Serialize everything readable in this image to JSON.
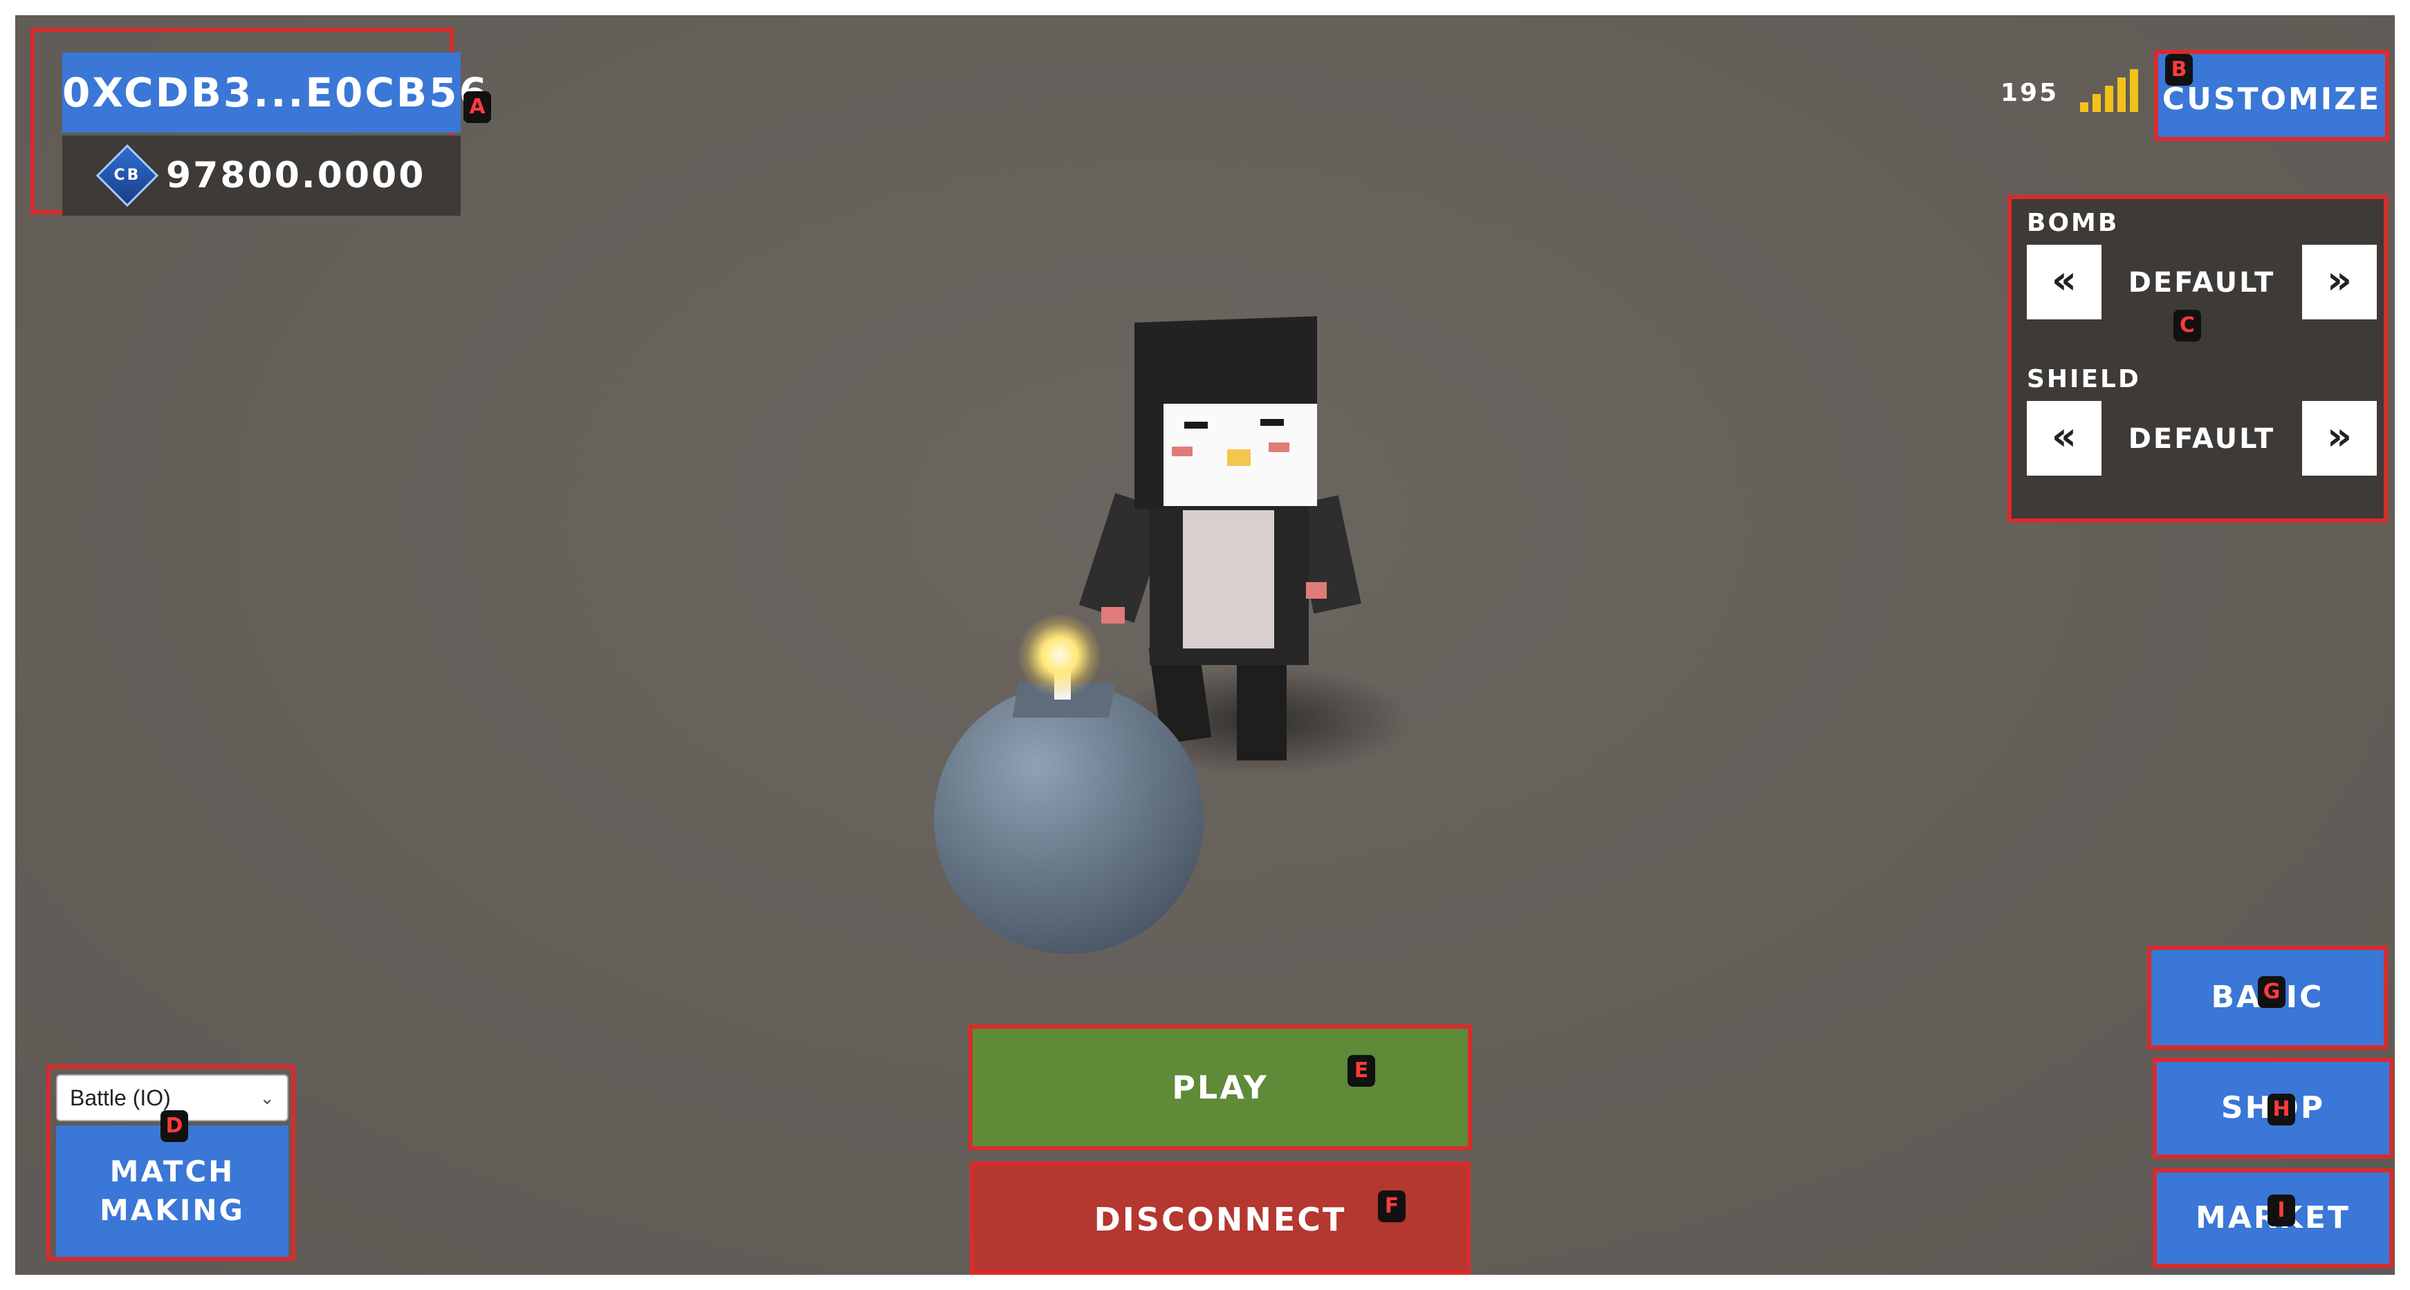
{
  "wallet": {
    "address": "0XCDB3...E0CB56",
    "coin_icon_text": "CB",
    "balance": "97800.0000"
  },
  "status": {
    "ping": "195",
    "signal_icon": "signal-bars-icon"
  },
  "header": {
    "customize_label": "CUSTOMIZE"
  },
  "loadout": {
    "bomb_label": "BOMB",
    "bomb_value": "DEFAULT",
    "shield_label": "SHIELD",
    "shield_value": "DEFAULT",
    "prev_symbol": "«",
    "next_symbol": "»"
  },
  "actions": {
    "play_label": "PLAY",
    "disconnect_label": "DISCONNECT"
  },
  "matchmaking": {
    "mode_selected": "Battle (IO)",
    "button_line1": "MATCH",
    "button_line2": "MAKING"
  },
  "side_menu": {
    "basic_label": "BASIC",
    "shop_label": "SHOP",
    "market_label": "MARKET"
  },
  "markers": [
    "A",
    "B",
    "C",
    "D",
    "E",
    "F",
    "G",
    "H",
    "I"
  ],
  "colors": {
    "accent_blue": "#3a77d6",
    "play_green": "#5f8a38",
    "disconnect_red": "#b43730",
    "highlight_red": "#d92b2b",
    "signal_yellow": "#f2c21b"
  }
}
